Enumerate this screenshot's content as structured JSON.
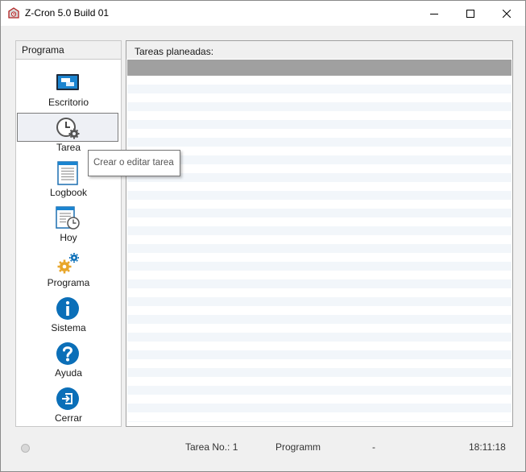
{
  "window": {
    "title": "Z-Cron 5.0 Build 01"
  },
  "sidebar": {
    "header": "Programa",
    "items": [
      {
        "label": "Escritorio",
        "icon": "desktop-icon"
      },
      {
        "label": "Tarea",
        "icon": "clock-gear-icon"
      },
      {
        "label": "Logbook",
        "icon": "logbook-icon"
      },
      {
        "label": "Hoy",
        "icon": "calendar-clock-icon"
      },
      {
        "label": "Programa",
        "icon": "gears-icon"
      },
      {
        "label": "Sistema",
        "icon": "info-icon"
      },
      {
        "label": "Ayuda",
        "icon": "help-icon"
      },
      {
        "label": "Cerrar",
        "icon": "exit-icon"
      }
    ],
    "selected": "Tarea"
  },
  "tooltip": {
    "text": "Crear o editar tarea"
  },
  "main": {
    "header": "Tareas planeadas:"
  },
  "status": {
    "task_no": "Tarea No.: 1",
    "program": "Programm",
    "separator": "-",
    "time": "18:11:18"
  },
  "colors": {
    "accent_blue": "#0b6fb8",
    "gear_orange": "#e8a62a",
    "row_stripe": "#f2f6fa",
    "header_bar": "#a0a0a0"
  }
}
